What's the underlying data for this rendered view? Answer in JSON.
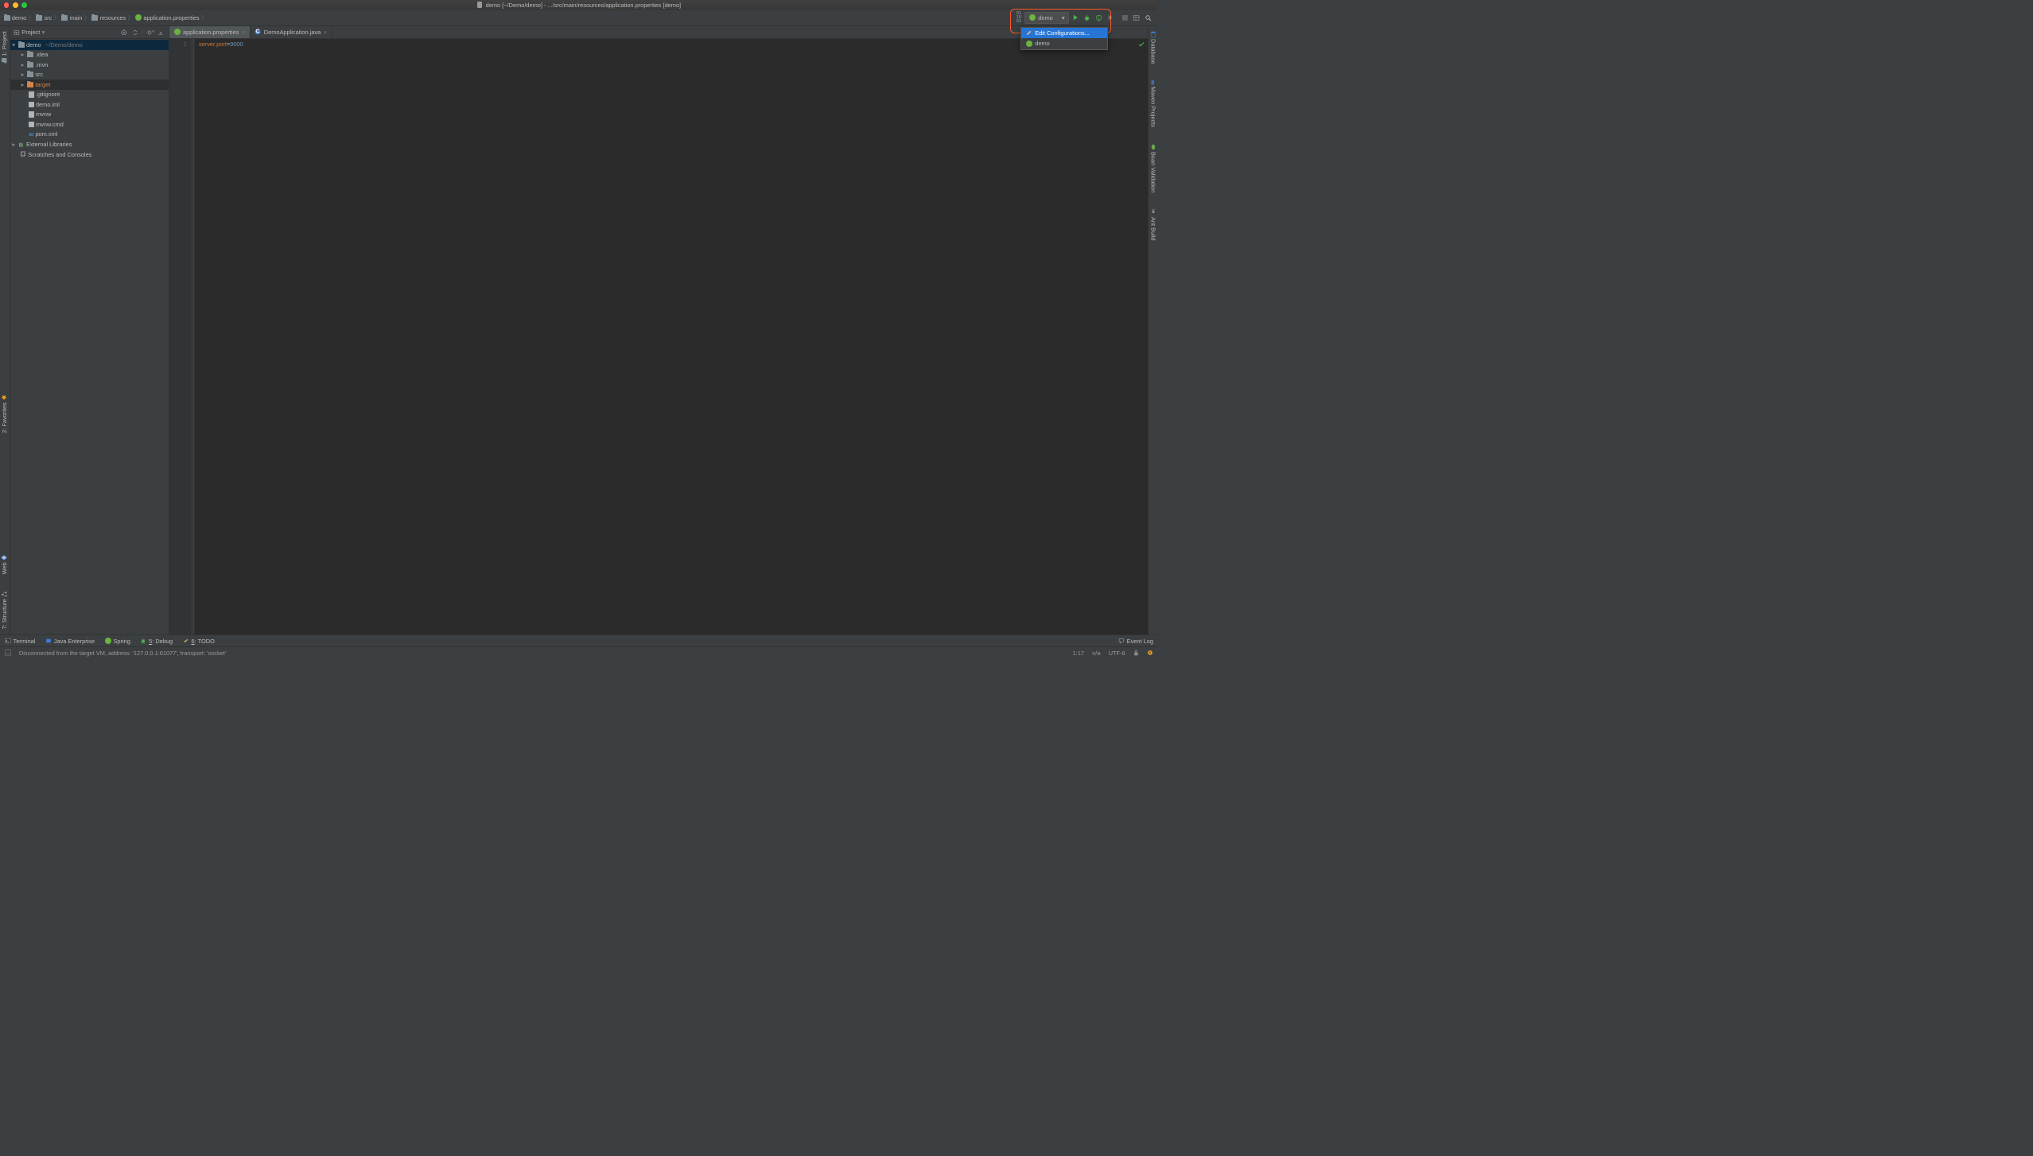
{
  "title": "demo [~/Demo/demo] - .../src/main/resources/application.properties [demo]",
  "breadcrumbs": [
    "demo",
    "src",
    "main",
    "resources",
    "application.properties"
  ],
  "runConfig": {
    "selected": "demo",
    "dropdown": {
      "edit": "Edit Configurations...",
      "item": "demo"
    }
  },
  "leftGutter": {
    "project": "1: Project",
    "favorites": "2: Favorites",
    "web": "Web",
    "structure": "7: Structure"
  },
  "rightGutter": {
    "database": "Database",
    "maven": "Maven Projects",
    "bean": "Bean Validation",
    "ant": "Ant Build"
  },
  "projectPanel": {
    "title": "Project"
  },
  "tree": {
    "root": {
      "name": "demo",
      "path": "~/Demo/demo"
    },
    "idea": ".idea",
    "mvn": ".mvn",
    "src": "src",
    "target": "target",
    "gitignore": ".gitignore",
    "demoiml": "demo.iml",
    "mvnw": "mvnw",
    "mvnwcmd": "mvnw.cmd",
    "pom": "pom.xml",
    "external": "External Libraries",
    "scratches": "Scratches and Consoles"
  },
  "editorTabs": {
    "t1": "application.properties",
    "t2": "DemoApplication.java"
  },
  "editor": {
    "lineNum": "1",
    "key": "server.port",
    "eq": "=",
    "val": "9000"
  },
  "bottomTabs": {
    "terminal": "Terminal",
    "javaee": "Java Enterprise",
    "spring": "Spring",
    "debug": "5: Debug",
    "todo": "6: TODO",
    "eventLog": "Event Log"
  },
  "status": {
    "msg": "Disconnected from the target VM, address: '127.0.0.1:61077', transport: 'socket'",
    "pos": "1:17",
    "insert": "n/a",
    "encoding": "UTF-8"
  }
}
